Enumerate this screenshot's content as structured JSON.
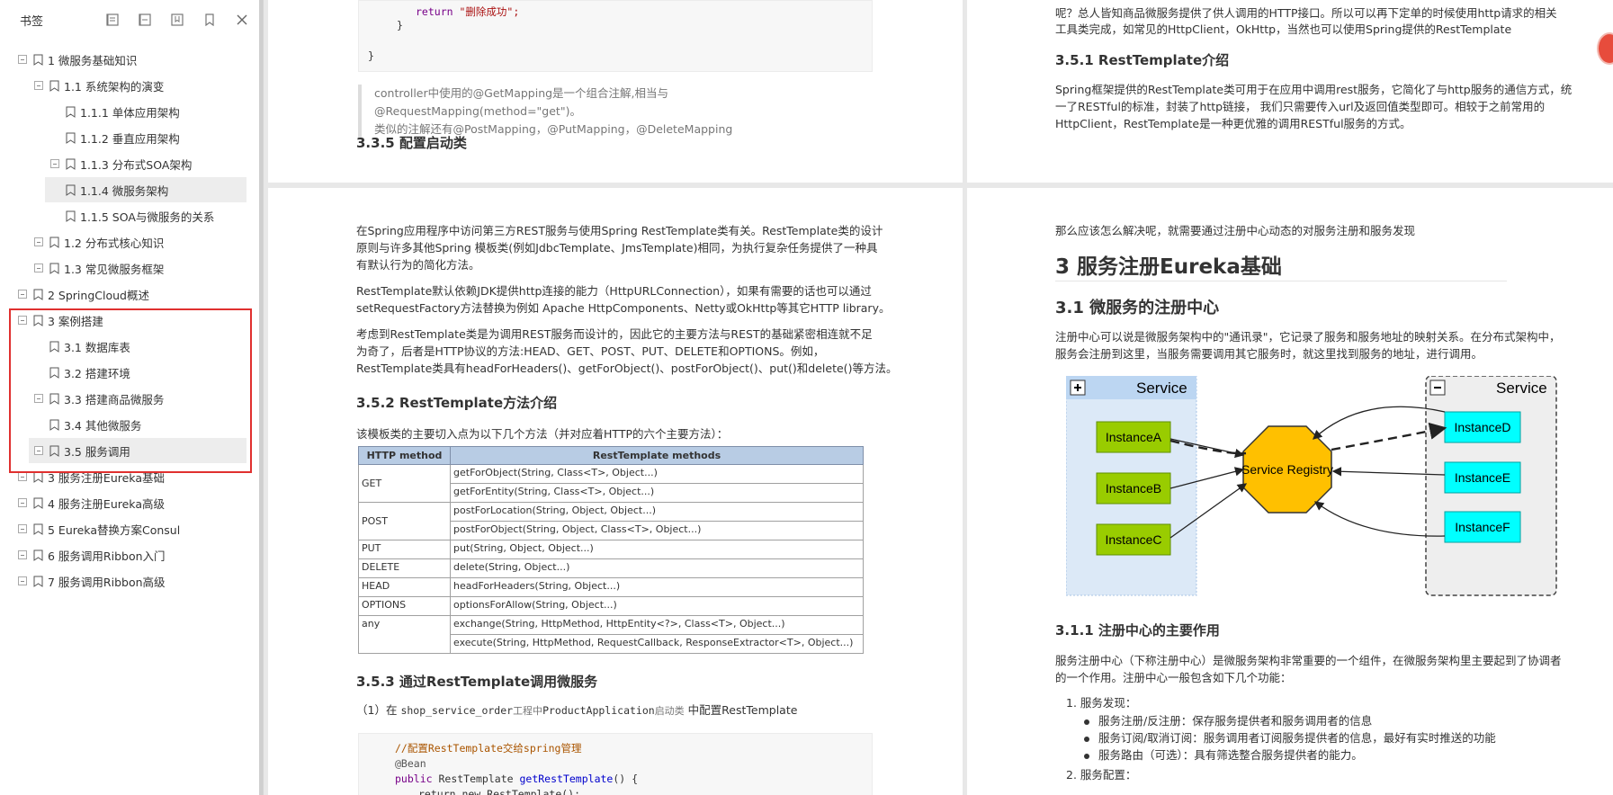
{
  "sidebar": {
    "title": "书签",
    "tools": [
      "expand-all-icon",
      "collapse-all-icon",
      "bookmark-add-icon",
      "bookmark-icon",
      "close-icon"
    ],
    "items": [
      {
        "label": "1 微服务基础知识",
        "level": 0,
        "expander": true
      },
      {
        "label": "1.1 系统架构的演变",
        "level": 1,
        "expander": true
      },
      {
        "label": "1.1.1 单体应用架构",
        "level": 2,
        "expander": false
      },
      {
        "label": "1.1.2 垂直应用架构",
        "level": 2,
        "expander": false
      },
      {
        "label": "1.1.3 分布式SOA架构",
        "level": 2,
        "expander": true
      },
      {
        "label": "1.1.4 微服务架构",
        "level": 2,
        "expander": false,
        "selected": true
      },
      {
        "label": "1.1.5 SOA与微服务的关系",
        "level": 2,
        "expander": false
      },
      {
        "label": "1.2 分布式核心知识",
        "level": 1,
        "expander": true
      },
      {
        "label": "1.3 常见微服务框架",
        "level": 1,
        "expander": true
      },
      {
        "label": "2 SpringCloud概述",
        "level": 0,
        "expander": true
      },
      {
        "label": "3 案例搭建",
        "level": 0,
        "expander": true
      },
      {
        "label": "3.1 数据库表",
        "level": 1,
        "expander": false
      },
      {
        "label": "3.2 搭建环境",
        "level": 1,
        "expander": false
      },
      {
        "label": "3.3 搭建商品微服务",
        "level": 1,
        "expander": true
      },
      {
        "label": "3.4 其他微服务",
        "level": 1,
        "expander": false
      },
      {
        "label": "3.5 服务调用",
        "level": 1,
        "expander": true,
        "selected": true
      },
      {
        "label": "3 服务注册Eureka基础",
        "level": 0,
        "expander": true
      },
      {
        "label": "4 服务注册Eureka高级",
        "level": 0,
        "expander": true
      },
      {
        "label": "5 Eureka替换方案Consul",
        "level": 0,
        "expander": true
      },
      {
        "label": "6 服务调用Ribbon入门",
        "level": 0,
        "expander": true
      },
      {
        "label": "7 服务调用Ribbon高级",
        "level": 0,
        "expander": true
      }
    ]
  },
  "page_tl": {
    "code_return_kw": "return",
    "code_return_str": "\"删除成功\";",
    "code_brace1": "}",
    "code_brace2": "}",
    "quote_line1": "controller中使用的@GetMapping是一个组合注解,相当与@RequestMapping(method=\"get\")。",
    "quote_line2": "类似的注解还有@PostMapping，@PutMapping，@DeleteMapping",
    "heading": "3.3.5 配置启动类"
  },
  "page_tr": {
    "line1": "呢？总人皆知商品微服务提供了供人调用的HTTP接口。所以可以再下定单的时候使用http请求的相关",
    "line2": "工具类完成，如常见的HttpClient，OkHttp，当然也可以使用Spring提供的RestTemplate",
    "heading": "3.5.1 RestTemplate介绍",
    "p1": "Spring框架提供的RestTemplate类可用于在应用中调用rest服务，它简化了与http服务的通信方式，统",
    "p2": "一了RESTful的标准，封装了http链接， 我们只需要传入url及返回值类型即可。相较于之前常用的",
    "p3": "HttpClient，RestTemplate是一种更优雅的调用RESTful服务的方式。"
  },
  "page_bl": {
    "p1_1": "在Spring应用程序中访问第三方REST服务与使用Spring RestTemplate类有关。RestTemplate类的设计",
    "p1_2": "原则与许多其他Spring 模板类(例如JdbcTemplate、JmsTemplate)相同，为执行复杂任务提供了一种具",
    "p1_3": "有默认行为的简化方法。",
    "p2_1": "RestTemplate默认依赖JDK提供http连接的能力（HttpURLConnection），如果有需要的话也可以通过",
    "p2_2": "setRequestFactory方法替换为例如 Apache HttpComponents、Netty或OkHttp等其它HTTP library。",
    "p3_1": "考虑到RestTemplate类是为调用REST服务而设计的，因此它的主要方法与REST的基础紧密相连就不足",
    "p3_2": "为奇了，后者是HTTP协议的方法:HEAD、GET、POST、PUT、DELETE和OPTIONS。例如，",
    "p3_3": "RestTemplate类具有headForHeaders()、getForObject()、postForObject()、put()和delete()等方法。",
    "heading2": "3.5.2 RestTemplate方法介绍",
    "table_intro": "该模板类的主要切入点为以下几个方法（并对应着HTTP的六个主要方法）：",
    "table": {
      "headers": [
        "HTTP method",
        "RestTemplate methods"
      ],
      "rows": [
        {
          "method": "GET",
          "methods": [
            "getForObject(String, Class<T>, Object...)",
            "getForEntity(String, Class<T>, Object...)"
          ]
        },
        {
          "method": "POST",
          "methods": [
            "postForLocation(String, Object, Object...)",
            "postForObject(String, Object, Class<T>, Object...)"
          ]
        },
        {
          "method": "PUT",
          "methods": [
            "put(String, Object, Object...)"
          ]
        },
        {
          "method": "DELETE",
          "methods": [
            "delete(String, Object...)"
          ]
        },
        {
          "method": "HEAD",
          "methods": [
            "headForHeaders(String, Object...)"
          ]
        },
        {
          "method": "OPTIONS",
          "methods": [
            "optionsForAllow(String, Object...)"
          ]
        },
        {
          "method": "any",
          "methods": [
            "exchange(String, HttpMethod, HttpEntity<?>, Class<T>, Object...)",
            "execute(String, HttpMethod, RequestCallback, ResponseExtractor<T>, Object...)"
          ]
        }
      ]
    },
    "heading3": "3.5.3 通过RestTemplate调用微服务",
    "step_prefix": "（1）在",
    "step_code1": "shop_service_order",
    "step_mid1": "工程中",
    "step_code2": "ProductApplication",
    "step_mid2": "启动类",
    "step_suffix": " 中配置RestTemplate",
    "code_comment": "//配置RestTemplate交给spring管理",
    "code_anno": "@Bean",
    "code_public": "public",
    "code_type": " RestTemplate ",
    "code_fn": "getRestTemplate",
    "code_sig_end": "() {",
    "code_return": "return new RestTemplate();"
  },
  "page_br": {
    "intro": "那么应该怎么解决呢，就需要通过注册中心动态的对服务注册和服务发现",
    "h1": "3 服务注册Eureka基础",
    "h2": "3.1 微服务的注册中心",
    "p1_1": "注册中心可以说是微服务架构中的\"通讯录\"，它记录了服务和服务地址的映射关系。在分布式架构中，",
    "p1_2": "服务会注册到这里，当服务需要调用其它服务时，就这里找到服务的地址，进行调用。",
    "diagram": {
      "left_title": "Service",
      "right_title": "Service",
      "center": "Service Registry",
      "left_instances": [
        "InstanceA",
        "InstanceB",
        "InstanceC"
      ],
      "right_instances": [
        "InstanceD",
        "InstanceE",
        "InstanceF"
      ],
      "colors": {
        "left_bg": "#dce9f7",
        "left_header": "#bcd6f2",
        "instance_green": "#99cc00",
        "instance_cyan": "#00ffff",
        "registry": "#ffc000",
        "right_bg": "#eeeeee"
      }
    },
    "h3": "3.1.1 注册中心的主要作用",
    "p2_1": "服务注册中心（下称注册中心）是微服务架构非常重要的一个组件，在微服务架构里主要起到了协调者",
    "p2_2": "的一个作用。注册中心一般包含如下几个功能：",
    "list1_title": "1. 服务发现：",
    "list1": [
      "服务注册/反注册：保存服务提供者和服务调用者的信息",
      "服务订阅/取消订阅：服务调用者订阅服务提供者的信息，最好有实时推送的功能",
      "服务路由（可选）：具有筛选整合服务提供者的能力。"
    ],
    "list2_title": "2. 服务配置："
  }
}
